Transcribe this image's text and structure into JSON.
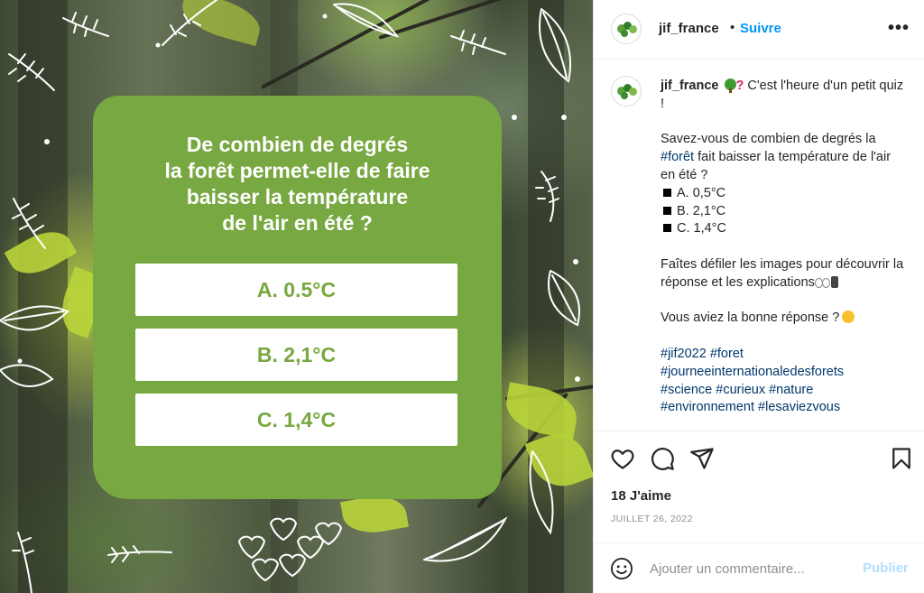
{
  "post_image": {
    "question_lines": [
      "De combien de degrés",
      "la forêt permet-elle de faire",
      "baisser la température",
      "de l'air en été ?"
    ],
    "answers": [
      "A. 0.5°C",
      "B. 2,1°C",
      "C. 1,4°C"
    ],
    "card_color": "#78a841"
  },
  "header": {
    "username": "jif_france",
    "separator": "•",
    "follow_label": "Suivre",
    "more_label": "•••"
  },
  "caption": {
    "username": "jif_france",
    "intro": "C'est l'heure d'un petit quiz !",
    "question_a": "Savez-vous de combien de degrés la",
    "question_hashtag": "#forêt",
    "question_b": "fait baisser la température de l'air en été ?",
    "options": [
      "A. 0,5°C",
      "B. 2,1°C",
      "C. 1,4°C"
    ],
    "scroll_text": "Faîtes défiler les images pour découvrir la réponse et les explications",
    "closing": "Vous aviez la bonne réponse ?",
    "hashtag_lines": [
      [
        "#jif2022",
        "#foret"
      ],
      [
        "#journeeinternationaledesforets"
      ],
      [
        "#science",
        "#curieux",
        "#nature"
      ],
      [
        "#environnement",
        "#lesaviezvous"
      ]
    ]
  },
  "actions": {
    "likes_text": "18 J'aime",
    "date_text": "JUILLET 26, 2022"
  },
  "comment": {
    "placeholder": "Ajouter un commentaire...",
    "publish_label": "Publier"
  },
  "colors": {
    "link_blue": "#0095f6",
    "hashtag_blue": "#00376b",
    "publish_disabled": "#b2dffc"
  }
}
